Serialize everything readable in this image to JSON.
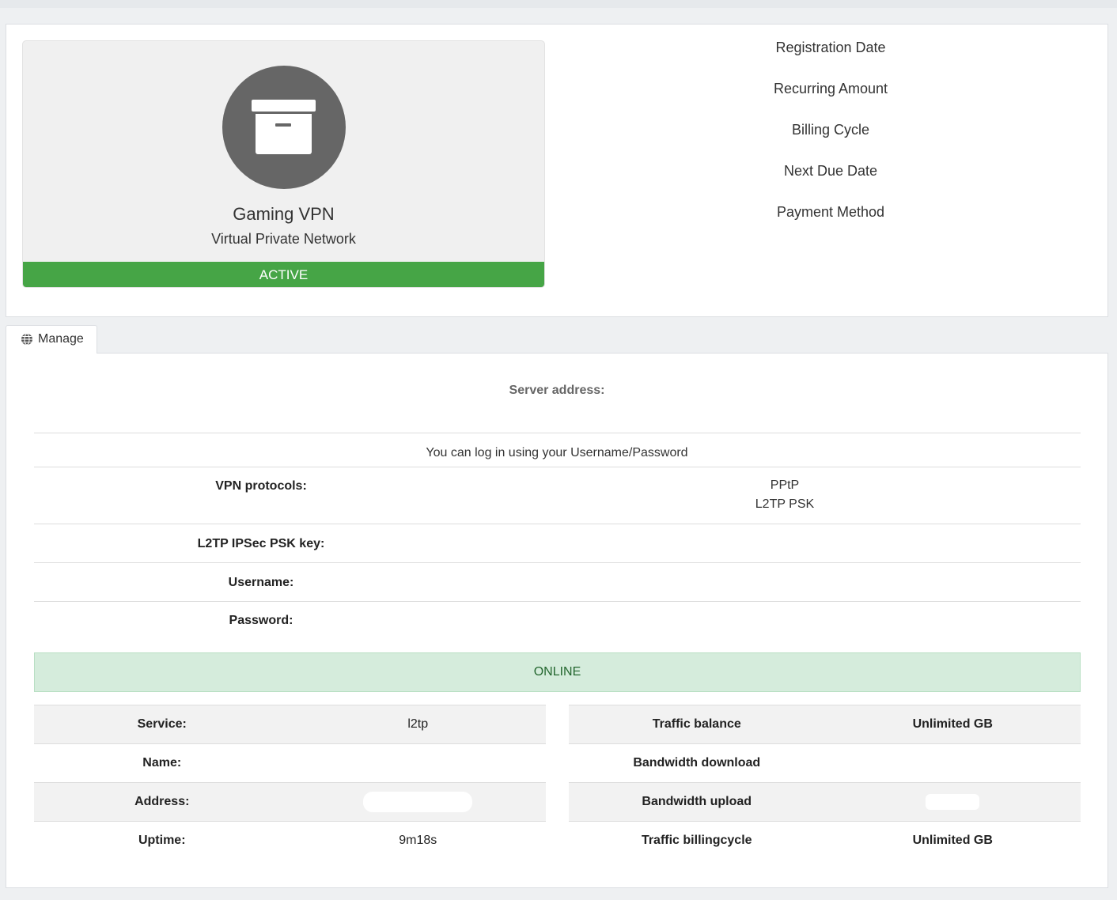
{
  "product": {
    "name": "Gaming VPN",
    "group": "Virtual Private Network",
    "status": "ACTIVE",
    "icon": "archive-box-icon",
    "status_color": "#46a546"
  },
  "billing": {
    "items": [
      "Registration Date",
      "Recurring Amount",
      "Billing Cycle",
      "Next Due Date",
      "Payment Method"
    ]
  },
  "tabs": [
    {
      "label": "Manage",
      "icon": "globe-icon"
    }
  ],
  "manage": {
    "server_address_label": "Server address:",
    "login_note": "You can log in using your Username/Password",
    "vpn_protocols_label": "VPN protocols:",
    "vpn_protocols": [
      "PPtP",
      "L2TP PSK"
    ],
    "psk_label": "L2TP IPSec PSK key:",
    "username_label": "Username:",
    "password_label": "Password:",
    "connection_status": "ONLINE",
    "online_color": "#d5ecdc"
  },
  "connection": [
    {
      "label": "Service:",
      "value": "l2tp"
    },
    {
      "label": "Name:",
      "value": ""
    },
    {
      "label": "Address:",
      "value": ""
    },
    {
      "label": "Uptime:",
      "value": "9m18s"
    }
  ],
  "traffic": [
    {
      "label": "Traffic balance",
      "value": "Unlimited GB"
    },
    {
      "label": "Bandwidth download",
      "value": ""
    },
    {
      "label": "Bandwidth upload",
      "value": ""
    },
    {
      "label": "Traffic billingcycle",
      "value": "Unlimited GB"
    }
  ]
}
